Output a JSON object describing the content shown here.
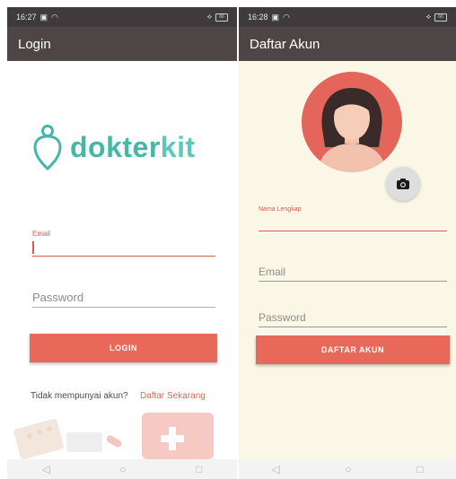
{
  "left_screen": {
    "status": {
      "time": "16:27",
      "battery": "66"
    },
    "appbar_title": "Login",
    "logo": {
      "part1": "dokter",
      "part2": "kit"
    },
    "email": {
      "label": "Email",
      "value": ""
    },
    "password": {
      "placeholder": "Password"
    },
    "login_button": "LOGIN",
    "no_account_text": "Tidak mempunyai akun?",
    "register_link": "Daftar Sekarang"
  },
  "right_screen": {
    "status": {
      "time": "16:28",
      "battery": "66"
    },
    "appbar_title": "Daftar Akun",
    "name_field": {
      "label": "Nama Lengkap",
      "value": ""
    },
    "email": {
      "placeholder": "Email"
    },
    "password": {
      "placeholder": "Password"
    },
    "register_button": "DAFTAR AKUN"
  },
  "navbar": {
    "back_icon": "◁",
    "home_icon": "○",
    "recents_icon": "□"
  },
  "colors": {
    "accent": "#e8685a",
    "appbar": "#4e4547",
    "statusbar": "#3f3b3c",
    "logo_teal": "#45b6a8",
    "register_bg": "#fbf7e6"
  }
}
